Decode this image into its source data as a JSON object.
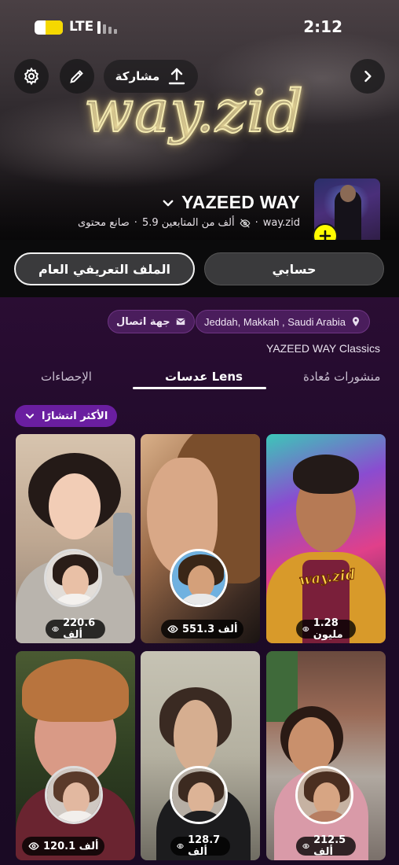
{
  "status_bar": {
    "network": "LTE",
    "time": "2:12",
    "battery_level": 0.6
  },
  "header": {
    "share_label": "مشاركة",
    "banner_text": "way.zid",
    "display_name": "YAZEED WAY",
    "username": "way.zid",
    "followers": "5.9 ألف من المتابعين",
    "category": "صانع محتوى"
  },
  "actions": {
    "public_profile": "الملف التعريفي العام",
    "my_account": "حسابي"
  },
  "info": {
    "location": "Jeddah, Makkah , Saudi Arabia",
    "contact": "جهة اتصال",
    "subtitle": "YAZEED WAY Classics"
  },
  "tabs": [
    {
      "label": "الإحصاءات",
      "active": false
    },
    {
      "label": "عدسات Lens",
      "active": true
    },
    {
      "label": "منشورات مُعادة",
      "active": false
    }
  ],
  "sort": {
    "label": "الأكثر انتشارًا"
  },
  "lenses": [
    {
      "views": "1.28 مليون",
      "overlay_text": "way.zid"
    },
    {
      "views": "551.3 ألف"
    },
    {
      "views": "220.6 ألف"
    },
    {
      "views": "212.5 ألف"
    },
    {
      "views": "128.7 ألف"
    },
    {
      "views": "120.1 ألف"
    }
  ],
  "icons": {
    "settings": "gear-icon",
    "edit": "pencil-icon",
    "share": "upload-icon",
    "forward": "chevron-right-icon",
    "add": "plus-icon",
    "location": "map-pin-icon",
    "contact": "mail-icon",
    "views": "eye-icon",
    "sort": "chevron-down-icon"
  },
  "colors": {
    "accent_yellow": "#fffc00",
    "sort_pill": "#6a1ea0",
    "chip_bg": "#4a1d5c",
    "background": "#1a0a24"
  }
}
